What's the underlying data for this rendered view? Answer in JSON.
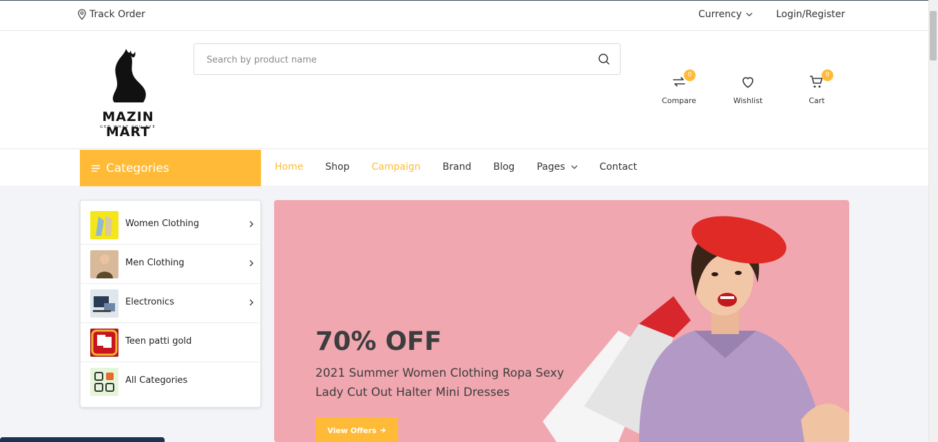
{
  "topbar": {
    "track_label": "Track Order",
    "currency_label": "Currency",
    "login_label": "Login/Register"
  },
  "logo": {
    "name": "MAZIN MART",
    "tagline": "GET WHAT YOU EYE"
  },
  "search": {
    "placeholder": "Search by product name"
  },
  "header_icons": {
    "compare": {
      "label": "Compare",
      "count": "0"
    },
    "wishlist": {
      "label": "Wishlist"
    },
    "cart": {
      "label": "Cart",
      "count": "0"
    }
  },
  "nav": {
    "categories_label": "Categories",
    "menu": [
      {
        "label": "Home"
      },
      {
        "label": "Shop"
      },
      {
        "label": "Campaign"
      },
      {
        "label": "Brand"
      },
      {
        "label": "Blog"
      },
      {
        "label": "Pages"
      },
      {
        "label": "Contact"
      }
    ]
  },
  "categories": [
    {
      "label": "Women Clothing"
    },
    {
      "label": "Men Clothing"
    },
    {
      "label": "Electronics"
    },
    {
      "label": "Teen patti gold"
    },
    {
      "label": "All Categories"
    }
  ],
  "banner": {
    "title": "70% OFF",
    "subtitle": "2021 Summer Women Clothing Ropa Sexy Lady Cut Out Halter Mini Dresses",
    "button_label": "View Offers"
  },
  "colors": {
    "accent": "#ffbb38",
    "banner_bg": "#f0a7b0",
    "page_bg": "#f2f4f8"
  }
}
